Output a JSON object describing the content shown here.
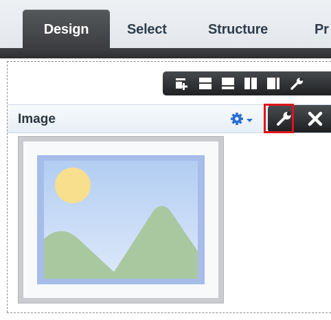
{
  "tabs": [
    {
      "label": "Design",
      "active": true
    },
    {
      "label": "Select",
      "active": false
    },
    {
      "label": "Structure",
      "active": false
    },
    {
      "label": "Pr",
      "active": false
    }
  ],
  "layout_toolbar": {
    "buttons": [
      {
        "icon": "add-box-icon"
      },
      {
        "icon": "stacked-layout-icon"
      },
      {
        "icon": "top-bar-layout-icon"
      },
      {
        "icon": "two-column-layout-icon"
      },
      {
        "icon": "right-column-layout-icon"
      },
      {
        "icon": "wrench-icon"
      }
    ]
  },
  "component": {
    "title": "Image",
    "gear_menu_icon": "gear-icon",
    "actions": [
      {
        "icon": "wrench-icon",
        "highlighted": true
      },
      {
        "icon": "close-icon"
      }
    ]
  },
  "colors": {
    "tab_active_bg": "#3b3d40",
    "highlight": "#e0141b",
    "header_bg": "#e6eef5",
    "gear": "#2a6fd1"
  }
}
